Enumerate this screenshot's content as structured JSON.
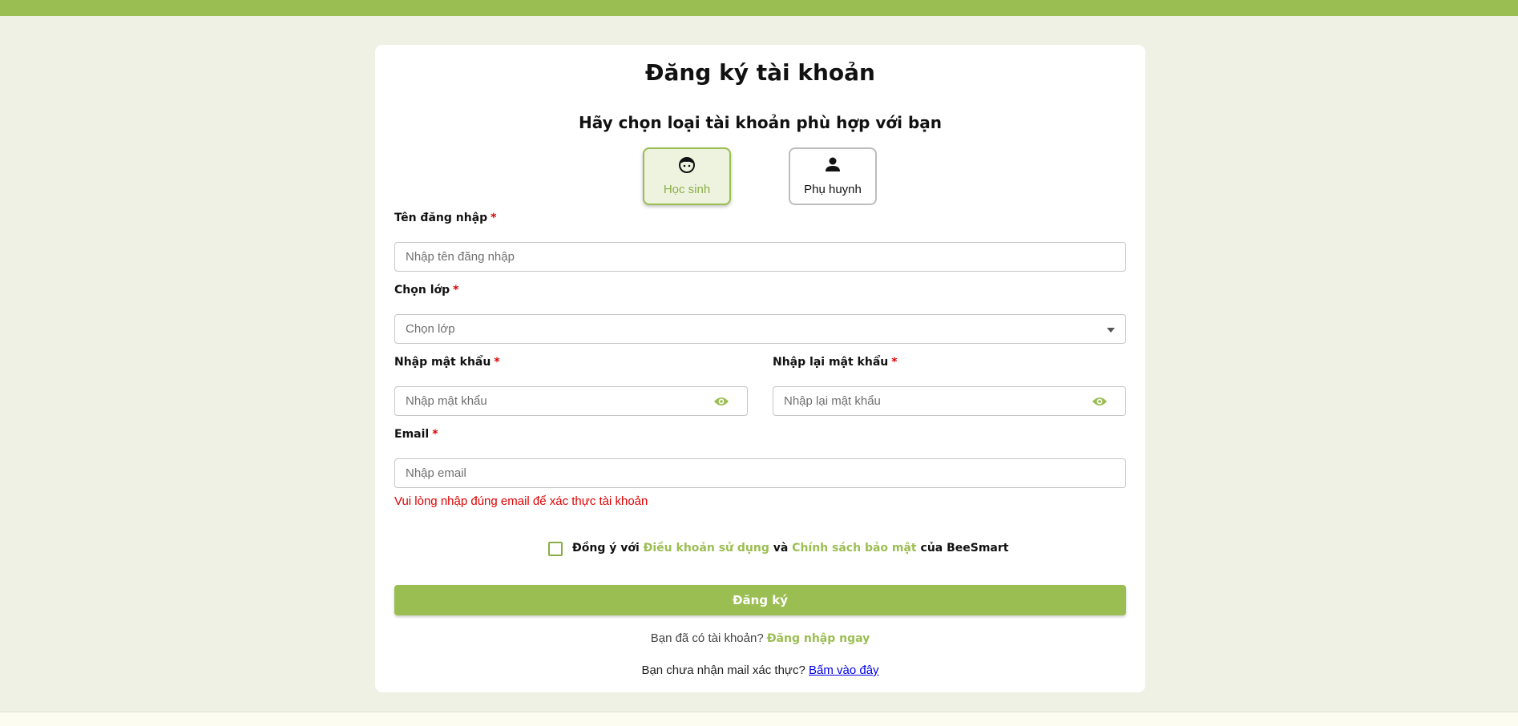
{
  "page": {
    "title": "Đăng ký tài khoản",
    "subtitle": "Hãy chọn loại tài khoản phù hợp với bạn"
  },
  "roles": [
    {
      "label": "Học sinh",
      "icon": "student-face-icon",
      "selected": true
    },
    {
      "label": "Phụ huynh",
      "icon": "person-icon",
      "selected": false
    }
  ],
  "form": {
    "required_mark": "*",
    "username": {
      "label": "Tên đăng nhập",
      "placeholder": "Nhập tên đăng nhập",
      "value": ""
    },
    "grade": {
      "label": "Chọn lớp",
      "selected": "Chọn lớp"
    },
    "password": {
      "label": "Nhập mật khẩu",
      "placeholder": "Nhập mật khẩu",
      "value": ""
    },
    "confirm_password": {
      "label": "Nhập lại mật khẩu",
      "placeholder": "Nhập lại mật khẩu",
      "value": ""
    },
    "email": {
      "label": "Email",
      "placeholder": "Nhập email",
      "value": "",
      "error": "Vui lòng nhập đúng email để xác thực tài khoản"
    }
  },
  "agreement": {
    "checked": false,
    "prefix": "Đồng ý với ",
    "terms_link": "Điều khoản sử dụng",
    "and": " và ",
    "privacy_link": "Chính sách bảo mật",
    "suffix": " của BeeSmart"
  },
  "submit_label": "Đăng ký",
  "login_prompt": {
    "text": "Bạn đã có tài khoản? ",
    "link": "Đăng nhập ngay"
  },
  "resend_prompt": {
    "text": "Bạn chưa nhận mail xác thực? ",
    "link": "Bấm vào đây"
  },
  "colors": {
    "accent": "#9bbe52",
    "error": "#e00000",
    "background": "#eef1e4",
    "link": "#0000ee"
  }
}
